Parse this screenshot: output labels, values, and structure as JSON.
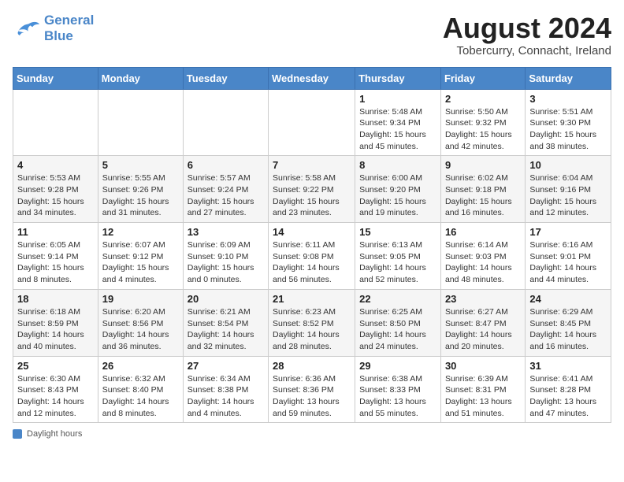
{
  "header": {
    "logo_line1": "General",
    "logo_line2": "Blue",
    "month_year": "August 2024",
    "location": "Tobercurry, Connacht, Ireland"
  },
  "days_of_week": [
    "Sunday",
    "Monday",
    "Tuesday",
    "Wednesday",
    "Thursday",
    "Friday",
    "Saturday"
  ],
  "weeks": [
    [
      {
        "num": "",
        "info": ""
      },
      {
        "num": "",
        "info": ""
      },
      {
        "num": "",
        "info": ""
      },
      {
        "num": "",
        "info": ""
      },
      {
        "num": "1",
        "info": "Sunrise: 5:48 AM\nSunset: 9:34 PM\nDaylight: 15 hours\nand 45 minutes."
      },
      {
        "num": "2",
        "info": "Sunrise: 5:50 AM\nSunset: 9:32 PM\nDaylight: 15 hours\nand 42 minutes."
      },
      {
        "num": "3",
        "info": "Sunrise: 5:51 AM\nSunset: 9:30 PM\nDaylight: 15 hours\nand 38 minutes."
      }
    ],
    [
      {
        "num": "4",
        "info": "Sunrise: 5:53 AM\nSunset: 9:28 PM\nDaylight: 15 hours\nand 34 minutes."
      },
      {
        "num": "5",
        "info": "Sunrise: 5:55 AM\nSunset: 9:26 PM\nDaylight: 15 hours\nand 31 minutes."
      },
      {
        "num": "6",
        "info": "Sunrise: 5:57 AM\nSunset: 9:24 PM\nDaylight: 15 hours\nand 27 minutes."
      },
      {
        "num": "7",
        "info": "Sunrise: 5:58 AM\nSunset: 9:22 PM\nDaylight: 15 hours\nand 23 minutes."
      },
      {
        "num": "8",
        "info": "Sunrise: 6:00 AM\nSunset: 9:20 PM\nDaylight: 15 hours\nand 19 minutes."
      },
      {
        "num": "9",
        "info": "Sunrise: 6:02 AM\nSunset: 9:18 PM\nDaylight: 15 hours\nand 16 minutes."
      },
      {
        "num": "10",
        "info": "Sunrise: 6:04 AM\nSunset: 9:16 PM\nDaylight: 15 hours\nand 12 minutes."
      }
    ],
    [
      {
        "num": "11",
        "info": "Sunrise: 6:05 AM\nSunset: 9:14 PM\nDaylight: 15 hours\nand 8 minutes."
      },
      {
        "num": "12",
        "info": "Sunrise: 6:07 AM\nSunset: 9:12 PM\nDaylight: 15 hours\nand 4 minutes."
      },
      {
        "num": "13",
        "info": "Sunrise: 6:09 AM\nSunset: 9:10 PM\nDaylight: 15 hours\nand 0 minutes."
      },
      {
        "num": "14",
        "info": "Sunrise: 6:11 AM\nSunset: 9:08 PM\nDaylight: 14 hours\nand 56 minutes."
      },
      {
        "num": "15",
        "info": "Sunrise: 6:13 AM\nSunset: 9:05 PM\nDaylight: 14 hours\nand 52 minutes."
      },
      {
        "num": "16",
        "info": "Sunrise: 6:14 AM\nSunset: 9:03 PM\nDaylight: 14 hours\nand 48 minutes."
      },
      {
        "num": "17",
        "info": "Sunrise: 6:16 AM\nSunset: 9:01 PM\nDaylight: 14 hours\nand 44 minutes."
      }
    ],
    [
      {
        "num": "18",
        "info": "Sunrise: 6:18 AM\nSunset: 8:59 PM\nDaylight: 14 hours\nand 40 minutes."
      },
      {
        "num": "19",
        "info": "Sunrise: 6:20 AM\nSunset: 8:56 PM\nDaylight: 14 hours\nand 36 minutes."
      },
      {
        "num": "20",
        "info": "Sunrise: 6:21 AM\nSunset: 8:54 PM\nDaylight: 14 hours\nand 32 minutes."
      },
      {
        "num": "21",
        "info": "Sunrise: 6:23 AM\nSunset: 8:52 PM\nDaylight: 14 hours\nand 28 minutes."
      },
      {
        "num": "22",
        "info": "Sunrise: 6:25 AM\nSunset: 8:50 PM\nDaylight: 14 hours\nand 24 minutes."
      },
      {
        "num": "23",
        "info": "Sunrise: 6:27 AM\nSunset: 8:47 PM\nDaylight: 14 hours\nand 20 minutes."
      },
      {
        "num": "24",
        "info": "Sunrise: 6:29 AM\nSunset: 8:45 PM\nDaylight: 14 hours\nand 16 minutes."
      }
    ],
    [
      {
        "num": "25",
        "info": "Sunrise: 6:30 AM\nSunset: 8:43 PM\nDaylight: 14 hours\nand 12 minutes."
      },
      {
        "num": "26",
        "info": "Sunrise: 6:32 AM\nSunset: 8:40 PM\nDaylight: 14 hours\nand 8 minutes."
      },
      {
        "num": "27",
        "info": "Sunrise: 6:34 AM\nSunset: 8:38 PM\nDaylight: 14 hours\nand 4 minutes."
      },
      {
        "num": "28",
        "info": "Sunrise: 6:36 AM\nSunset: 8:36 PM\nDaylight: 13 hours\nand 59 minutes."
      },
      {
        "num": "29",
        "info": "Sunrise: 6:38 AM\nSunset: 8:33 PM\nDaylight: 13 hours\nand 55 minutes."
      },
      {
        "num": "30",
        "info": "Sunrise: 6:39 AM\nSunset: 8:31 PM\nDaylight: 13 hours\nand 51 minutes."
      },
      {
        "num": "31",
        "info": "Sunrise: 6:41 AM\nSunset: 8:28 PM\nDaylight: 13 hours\nand 47 minutes."
      }
    ]
  ],
  "footer": {
    "label": "Daylight hours"
  }
}
